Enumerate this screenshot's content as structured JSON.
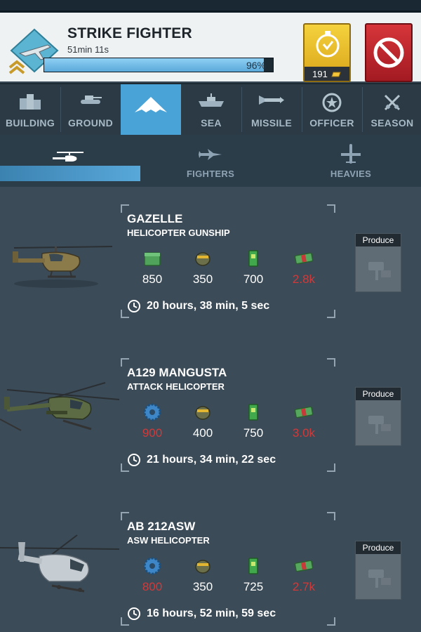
{
  "header": {
    "title": "STRIKE FIGHTER",
    "time_remaining": "51min 11s",
    "progress_percent": 96,
    "progress_label": "96%",
    "speedup_cost": "191",
    "icons": {
      "rank": "strike-fighter-rank-icon",
      "speedup": "stopwatch-icon",
      "cancel": "cancel-icon",
      "currency": "gold-bar-icon"
    }
  },
  "categories": [
    {
      "label": "BUILDING",
      "icon": "building-icon"
    },
    {
      "label": "GROUND",
      "icon": "tank-icon"
    },
    {
      "label": "",
      "icon": "stealth-bomber-icon",
      "active": true
    },
    {
      "label": "SEA",
      "icon": "ship-icon"
    },
    {
      "label": "MISSILE",
      "icon": "missile-icon"
    },
    {
      "label": "OFFICER",
      "icon": "star-badge-icon"
    },
    {
      "label": "SEASON",
      "icon": "crossed-swords-icon"
    }
  ],
  "subtabs": [
    {
      "label": "",
      "icon": "helicopter-icon",
      "active": true
    },
    {
      "label": "FIGHTERS",
      "icon": "fighter-jet-icon"
    },
    {
      "label": "HEAVIES",
      "icon": "heavy-plane-icon"
    }
  ],
  "units": [
    {
      "name": "GAZELLE",
      "type": "HELICOPTER GUNSHIP",
      "resources": [
        {
          "icon": "ammo-crate-icon",
          "value": "850",
          "short": false
        },
        {
          "icon": "fuel-icon",
          "value": "350",
          "short": false
        },
        {
          "icon": "circuit-chip-icon",
          "value": "700",
          "short": false
        },
        {
          "icon": "cash-icon",
          "value": "2.8k",
          "short": true
        }
      ],
      "time": "20 hours, 38 min, 5 sec",
      "produce_label": "Produce"
    },
    {
      "name": "A129 MANGUSTA",
      "type": "ATTACK HELICOPTER",
      "resources": [
        {
          "icon": "gear-icon",
          "value": "900",
          "short": true
        },
        {
          "icon": "fuel-icon",
          "value": "400",
          "short": false
        },
        {
          "icon": "circuit-chip-icon",
          "value": "750",
          "short": false
        },
        {
          "icon": "cash-icon",
          "value": "3.0k",
          "short": true
        }
      ],
      "time": "21 hours, 34 min, 22 sec",
      "produce_label": "Produce"
    },
    {
      "name": "AB 212ASW",
      "type": "ASW HELICOPTER",
      "resources": [
        {
          "icon": "gear-icon",
          "value": "800",
          "short": true
        },
        {
          "icon": "fuel-icon",
          "value": "350",
          "short": false
        },
        {
          "icon": "circuit-chip-icon",
          "value": "725",
          "short": false
        },
        {
          "icon": "cash-icon",
          "value": "2.7k",
          "short": true
        }
      ],
      "time": "16 hours, 52 min, 59 sec",
      "produce_label": "Produce"
    }
  ],
  "colors": {
    "accent_blue": "#4aa3d6",
    "shortage_red": "#d13a3a",
    "speedup_gold": "#f0c52f",
    "cancel_red": "#c4252c"
  }
}
